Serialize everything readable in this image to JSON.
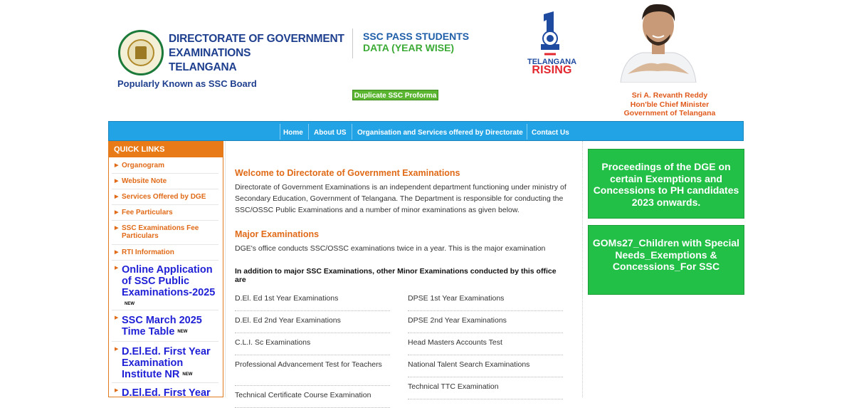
{
  "header": {
    "dge_title_lines": [
      "DIRECTORATE OF GOVERNMENT",
      "EXAMINATIONS",
      "TELANGANA"
    ],
    "popular": "Popularly Known as SSC Board",
    "ssc_pass_line1": "SSC PASS STUDENTS",
    "ssc_pass_line2": "DATA (YEAR WISE)",
    "duplicate_button": "Duplicate SSC Proforma",
    "telangana_line1": "TELANGANA",
    "telangana_line2": "RISING",
    "cm_lines": [
      "Sri A. Revanth Reddy",
      "Hon'ble Chief Minister",
      "Government of Telangana"
    ]
  },
  "nav": {
    "items": [
      "Home",
      "About US",
      "Organisation and Services offered by Directorate",
      "Contact Us"
    ]
  },
  "quick_links": {
    "title": "QUICK LINKS",
    "items": [
      "Organogram",
      "Website Note",
      "Services Offered by DGE",
      "Fee Particulars",
      "SSC Examinations Fee Particulars",
      "RTI Information"
    ],
    "highlight": [
      {
        "text": "Online Application of SSC Public Examinations-2025",
        "badge": "NEW"
      },
      {
        "text": "SSC March 2025 Time Table",
        "badge": "NEW"
      },
      {
        "text": "D.El.Ed. First Year Examination Institute NR",
        "badge": "NEW"
      },
      {
        "text": "D.El.Ed. First Year",
        "badge": ""
      }
    ]
  },
  "main": {
    "welcome_title": "Welcome to Directorate of Government Examinations",
    "welcome_text": "Directorate of Government Examinations is an independent department functioning under ministry of Secondary Education, Government of Telangana. The Department is responsible for conducting the SSC/OSSC Public Examinations and a number of minor examinations as given below.",
    "major_title": "Major Examinations",
    "major_text": "DGE's office conducts SSC/OSSC examinations twice in a year. This is the major examination",
    "minor_intro": "In addition to major SSC Examinations, other Minor Examinations conducted by this office are",
    "minor_left": [
      "D.El. Ed 1st Year Examinations",
      "D.El. Ed 2nd Year Examinations",
      "C.L.I. Sc Examinations",
      "Professional Advancement Test for Teachers",
      "Technical Certificate Course Examination"
    ],
    "minor_right": [
      "DPSE 1st Year Examinations",
      "DPSE 2nd Year Examinations",
      "Head Masters Accounts Test",
      "National Talent Search Examinations",
      "Technical TTC Examination"
    ]
  },
  "right": {
    "box1": "Proceedings of the DGE on certain Exemptions and Concessions to PH candidates 2023 onwards.",
    "box2": "GOMs27_Children with Special Needs_Exemptions & Concessions_For SSC"
  },
  "colors": {
    "nav_blue": "#21a3e6",
    "quick_orange": "#e97a18",
    "green_box": "#22c046",
    "title_blue": "#1f3f8f"
  }
}
